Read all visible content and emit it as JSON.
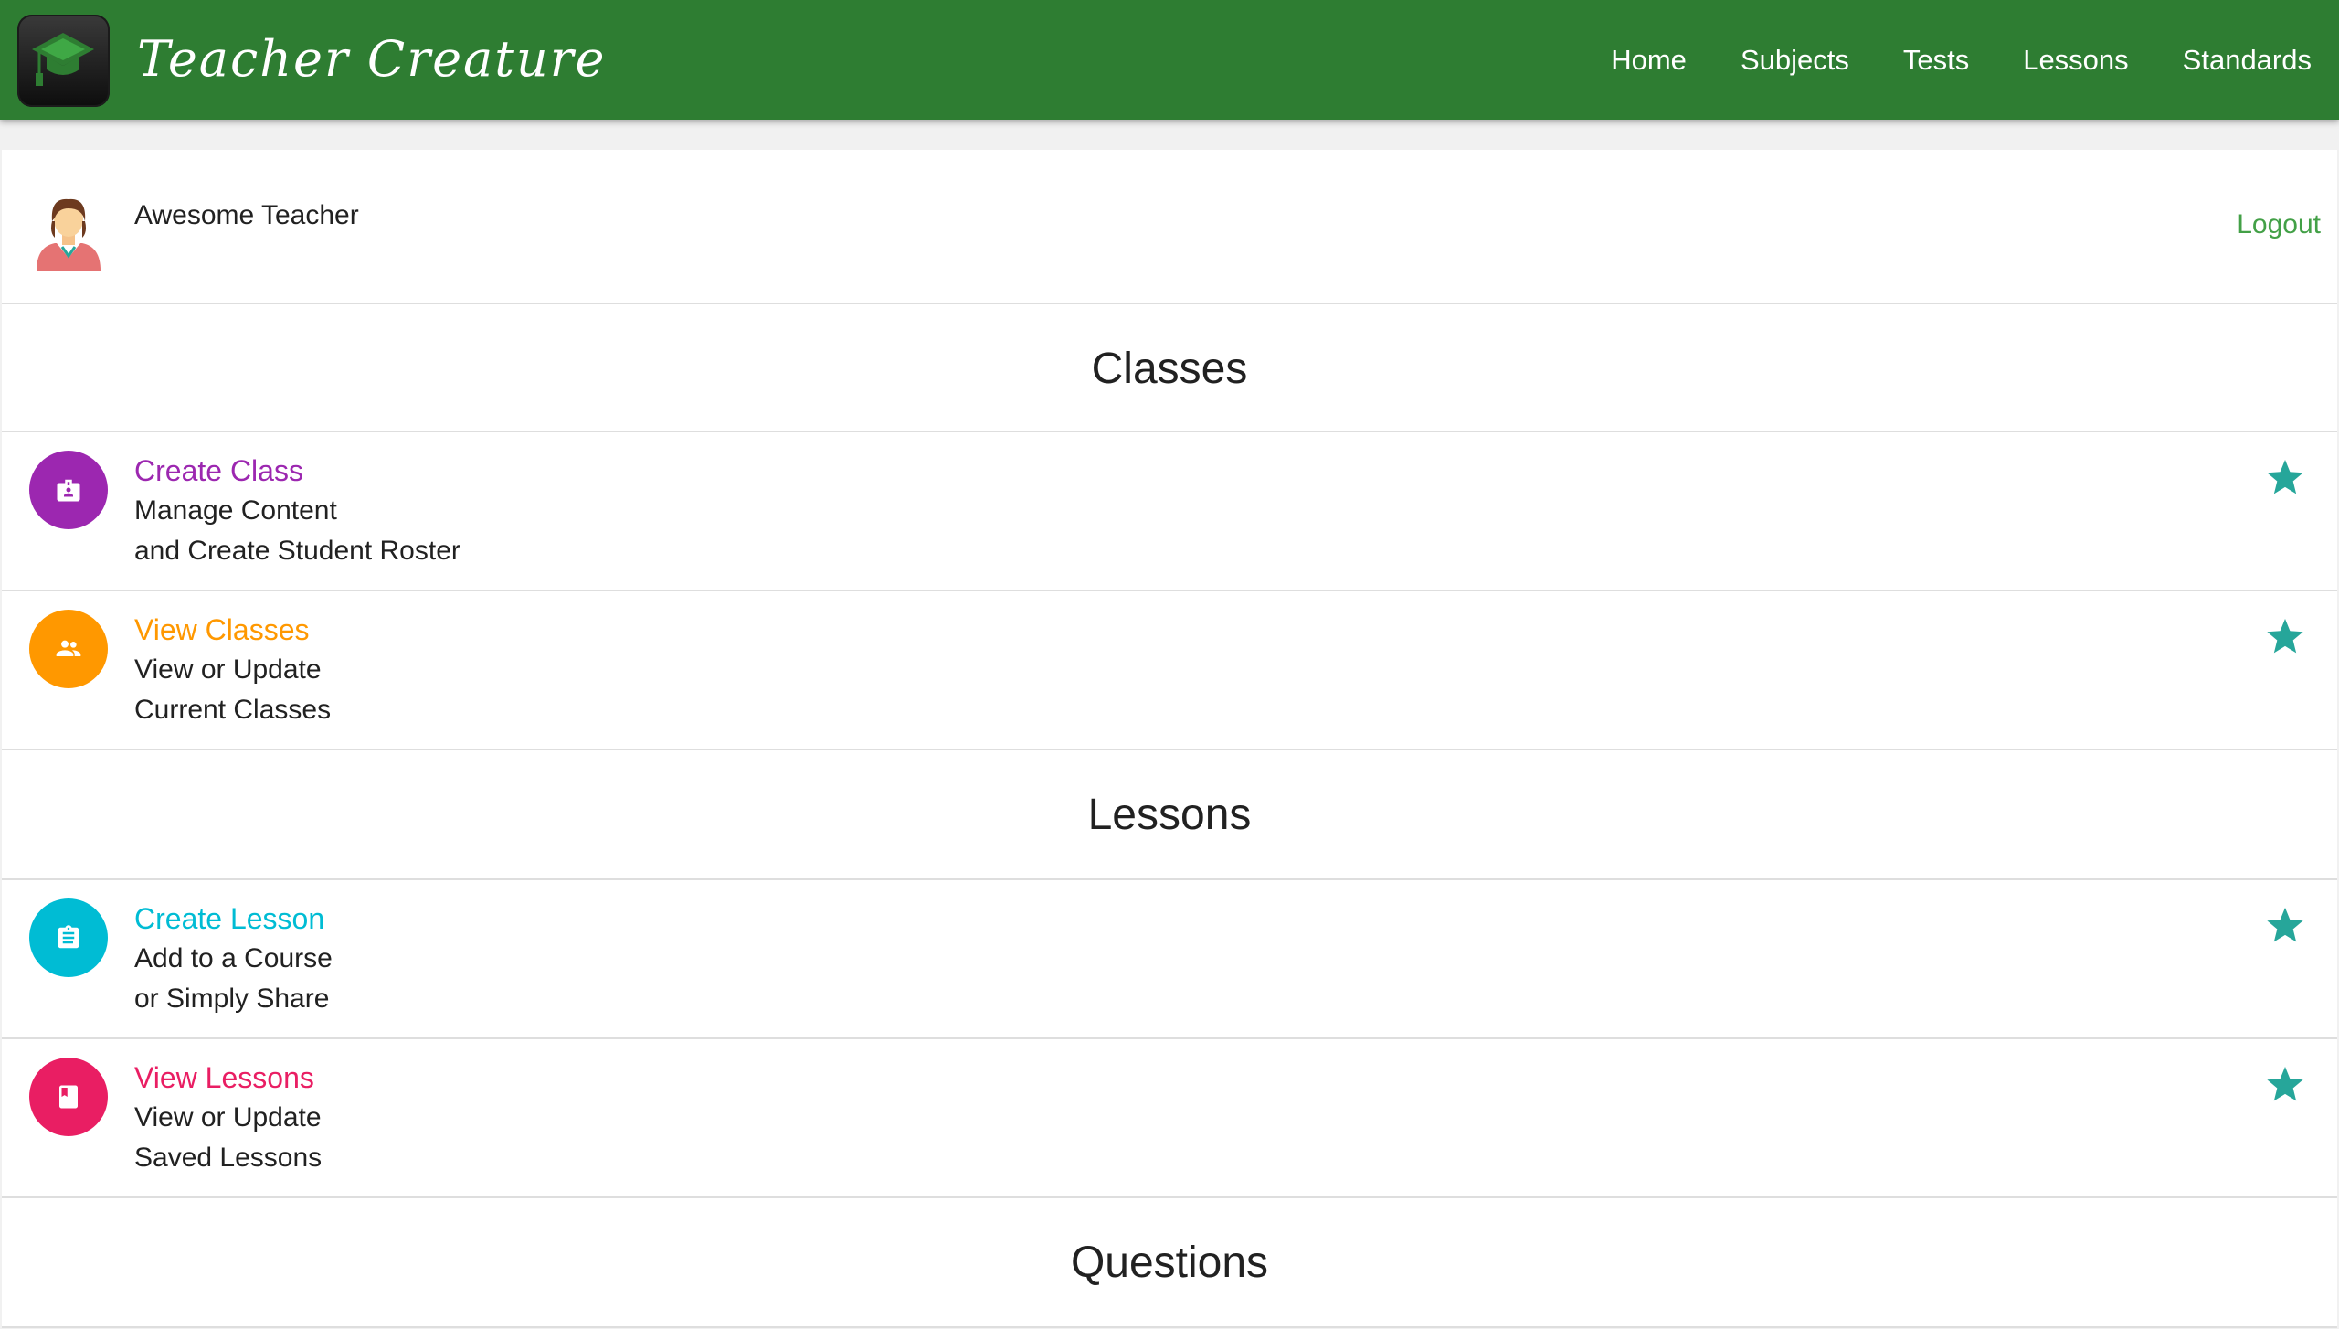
{
  "header": {
    "brand": "Teacher Creature",
    "brand_color": "#2e7d32",
    "nav": [
      "Home",
      "Subjects",
      "Tests",
      "Lessons",
      "Standards"
    ]
  },
  "user": {
    "name": "Awesome Teacher",
    "logout": "Logout",
    "avatar_icon": "teacher-avatar-icon"
  },
  "sections": {
    "classes": "Classes",
    "lessons": "Lessons",
    "questions": "Questions"
  },
  "items": {
    "create_class": {
      "title": "Create Class",
      "line1": "Manage Content",
      "line2": "and Create Student Roster",
      "color": "#9c27b0",
      "icon": "contact-badge-icon"
    },
    "view_classes": {
      "title": "View Classes",
      "line1": "View or Update",
      "line2": "Current Classes",
      "color": "#ff9800",
      "icon": "people-icon"
    },
    "create_lesson": {
      "title": "Create Lesson",
      "line1": "Add to a Course",
      "line2": "or Simply Share",
      "color": "#00bcd4",
      "icon": "clipboard-icon"
    },
    "view_lessons": {
      "title": "View Lessons",
      "line1": "View or Update",
      "line2": "Saved Lessons",
      "color": "#e91e63",
      "icon": "book-icon"
    }
  },
  "star_color": "#26a69a"
}
